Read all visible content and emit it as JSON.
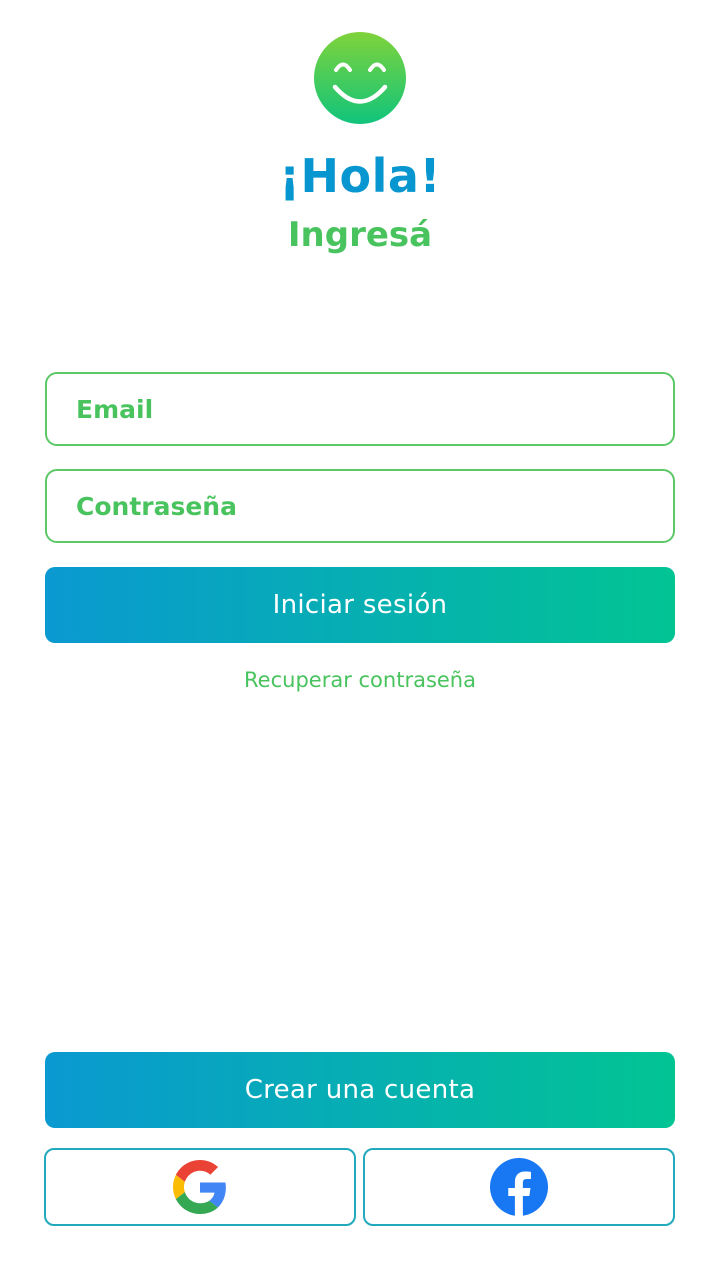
{
  "header": {
    "logo_icon": "smiley-face-icon",
    "title": "¡Hola!",
    "subtitle": "Ingresá"
  },
  "form": {
    "email_placeholder": "Email",
    "email_value": "",
    "password_placeholder": "Contraseña",
    "password_value": "",
    "login_label": "Iniciar sesión",
    "recover_label": "Recuperar contraseña"
  },
  "footer": {
    "create_account_label": "Crear una cuenta",
    "social": [
      {
        "provider": "google",
        "icon": "google-icon"
      },
      {
        "provider": "facebook",
        "icon": "facebook-icon"
      }
    ]
  },
  "colors": {
    "title_blue": "#0796cf",
    "accent_green": "#49c35d",
    "gradient_start": "#0a99d1",
    "gradient_end": "#02c493",
    "facebook_blue": "#1877f2"
  }
}
